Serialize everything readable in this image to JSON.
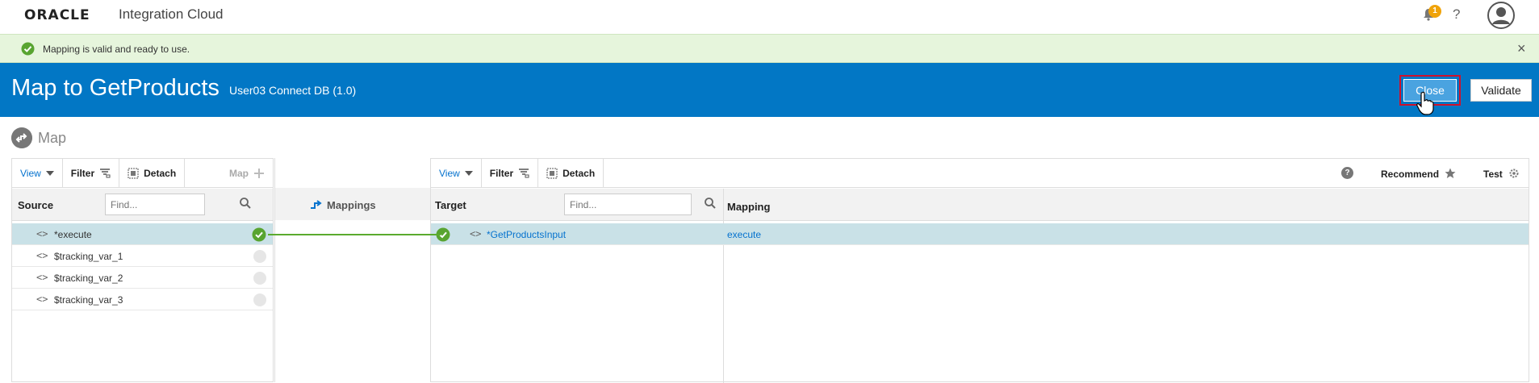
{
  "app": {
    "logo": "ORACLE",
    "product": "Integration Cloud",
    "notification_count": "1",
    "help_glyph": "?"
  },
  "banner": {
    "message": "Mapping is valid and ready to use.",
    "close_glyph": "×"
  },
  "header": {
    "title": "Map to GetProducts",
    "subtitle": "User03 Connect DB (1.0)",
    "close_label": "Close",
    "validate_label": "Validate",
    "bg_color": "#0277c5"
  },
  "section": {
    "label": "Map"
  },
  "source": {
    "toolbar": {
      "view": "View",
      "filter": "Filter",
      "detach": "Detach",
      "map": "Map"
    },
    "column_label": "Source",
    "find_placeholder": "Find...",
    "rows": [
      {
        "code": "<>",
        "name": "*execute",
        "mapped": true,
        "selected": true
      },
      {
        "code": "<>",
        "name": "$tracking_var_1",
        "mapped": false,
        "selected": false
      },
      {
        "code": "<>",
        "name": "$tracking_var_2",
        "mapped": false,
        "selected": false
      },
      {
        "code": "<>",
        "name": "$tracking_var_3",
        "mapped": false,
        "selected": false
      }
    ]
  },
  "mappings": {
    "title": "Mappings"
  },
  "target": {
    "toolbar": {
      "view": "View",
      "filter": "Filter",
      "detach": "Detach",
      "help": "?",
      "recommend": "Recommend",
      "test": "Test"
    },
    "column_label": "Target",
    "mapping_label": "Mapping",
    "find_placeholder": "Find...",
    "rows": [
      {
        "code": "<>",
        "name": "*GetProductsInput",
        "mapping": "execute",
        "mapped": true,
        "selected": true
      }
    ]
  }
}
